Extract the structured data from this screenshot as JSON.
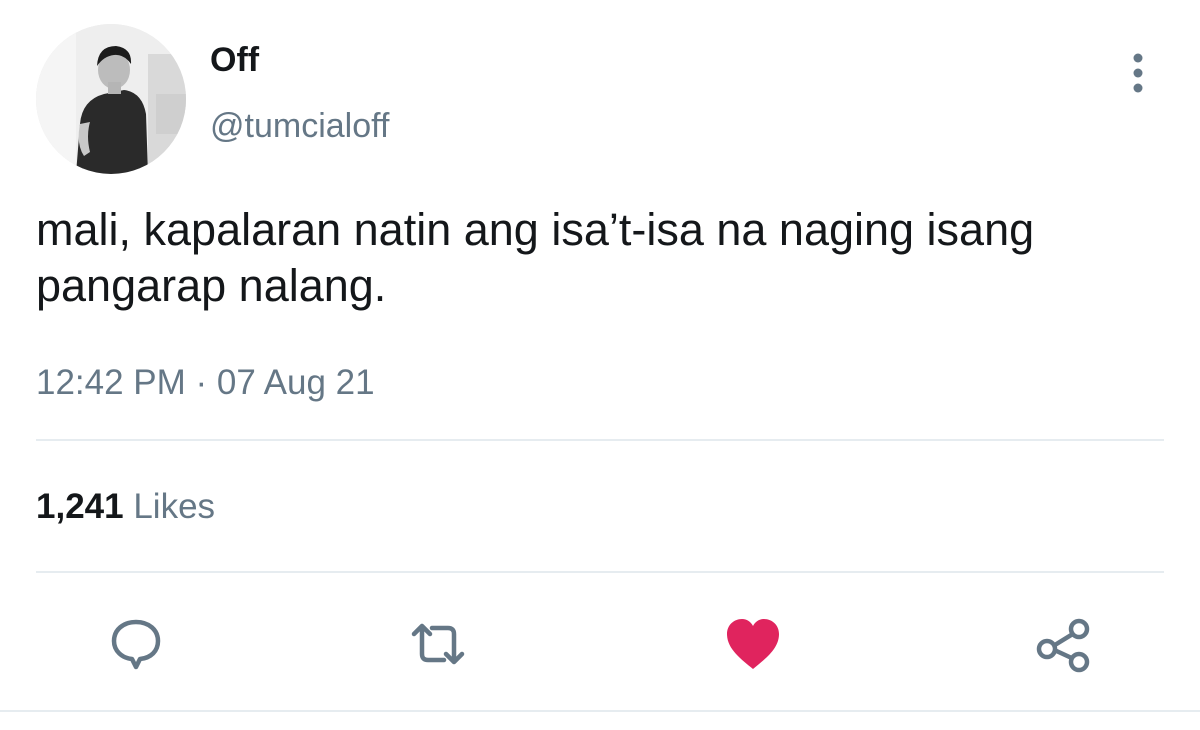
{
  "author": {
    "display_name": "Off",
    "handle": "@tumcialoff",
    "avatar_icon": "profile-photo"
  },
  "tweet": {
    "text": "mali, kapalaran natin ang isa’t-isa na naging isang pangarap nalang.",
    "timestamp": "12:42 PM · 07 Aug 21"
  },
  "stats": {
    "likes_count": "1,241",
    "likes_label": "Likes"
  },
  "actions": [
    {
      "name": "reply",
      "icon": "speech-bubble-icon"
    },
    {
      "name": "retweet",
      "icon": "retweet-icon"
    },
    {
      "name": "like",
      "icon": "heart-icon",
      "liked": true
    },
    {
      "name": "share",
      "icon": "share-icon"
    }
  ],
  "colors": {
    "text_primary": "#14171a",
    "text_secondary": "#657786",
    "icon": "#657786",
    "like": "#e0245e",
    "divider": "#e6ecf0"
  }
}
